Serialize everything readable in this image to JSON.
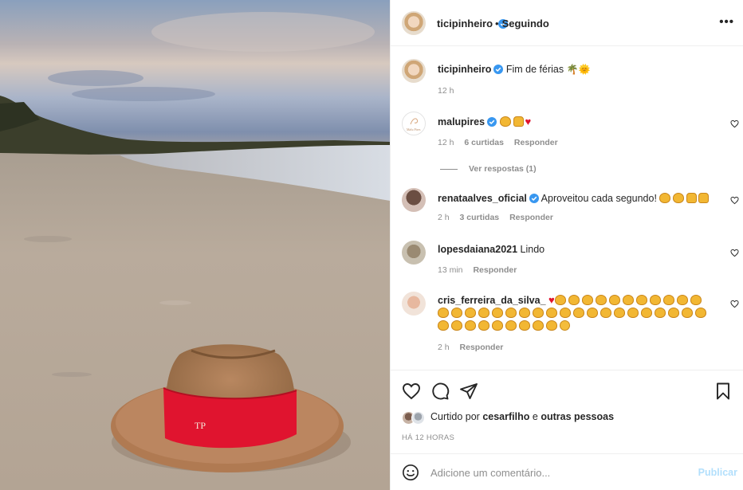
{
  "header": {
    "username": "ticipinheiro",
    "separator": "•",
    "follow_status": "Seguindo",
    "more": "•••"
  },
  "caption": {
    "username": "ticipinheiro",
    "text": "Fim de férias",
    "time": "12 h"
  },
  "comments": [
    {
      "username": "malupires",
      "verified": true,
      "avatar_text": "Malu Pires",
      "text": "",
      "time": "12 h",
      "likes": "6 curtidas",
      "reply": "Responder",
      "view_replies": "Ver respostas (1)"
    },
    {
      "username": "renataalves_oficial",
      "verified": true,
      "text": "Aproveitou cada segundo!",
      "time": "2 h",
      "likes": "3 curtidas",
      "reply": "Responder"
    },
    {
      "username": "lopesdaiana2021",
      "verified": false,
      "text": "Lindo",
      "time": "13 min",
      "reply": "Responder"
    },
    {
      "username": "cris_ferreira_da_silva_",
      "verified": false,
      "text": "",
      "time": "2 h",
      "reply": "Responder"
    }
  ],
  "actions": {
    "liked_by_prefix": "Curtido por",
    "liked_by_user": "cesarfilho",
    "liked_by_suffix": "e",
    "others": "outras pessoas",
    "time_ago": "HÁ 12 HORAS"
  },
  "add_comment": {
    "placeholder": "Adicione um comentário...",
    "publish": "Publicar"
  },
  "photo": {
    "hat_monogram": "TP"
  },
  "colors": {
    "verified": "#3897f0",
    "publish_disabled": "#b2dffc",
    "heart_red": "#e0142f",
    "hat_band": "#e0142f",
    "muted_text": "#8e8e8e"
  },
  "icons": {
    "like": "heart-outline-icon",
    "comment": "speech-bubble-icon",
    "share": "paper-plane-icon",
    "save": "bookmark-icon",
    "emoji": "smiley-icon",
    "more": "ellipsis-icon"
  }
}
